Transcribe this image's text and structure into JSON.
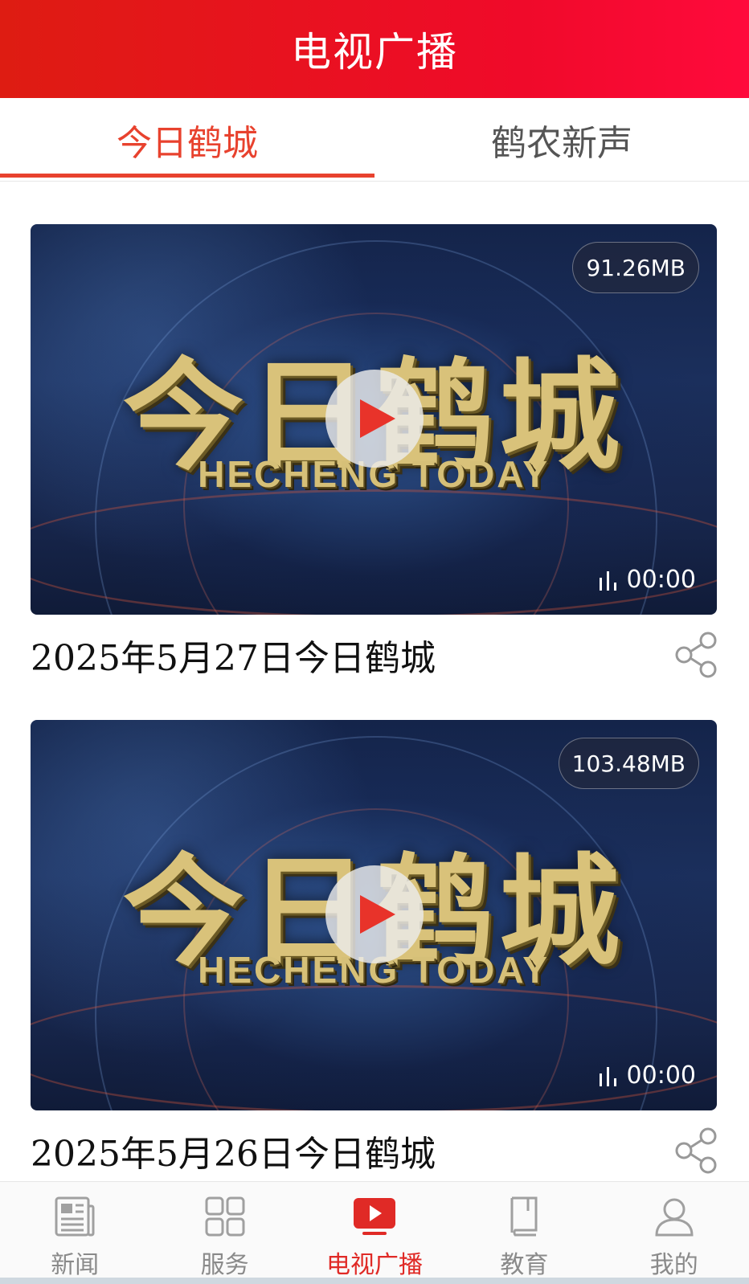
{
  "header": {
    "title": "电视广播"
  },
  "tabs": [
    {
      "label": "今日鹤城",
      "active": true
    },
    {
      "label": "鹤农新声",
      "active": false
    }
  ],
  "videos": [
    {
      "thumb_title_cn": "今日鹤城",
      "thumb_title_en": "HECHENG TODAY",
      "size": "91.26MB",
      "duration": "00:00",
      "title": "2025年5月27日今日鹤城"
    },
    {
      "thumb_title_cn": "今日鹤城",
      "thumb_title_en": "HECHENG TODAY",
      "size": "103.48MB",
      "duration": "00:00",
      "title": "2025年5月26日今日鹤城"
    }
  ],
  "bottom_nav": [
    {
      "label": "新闻",
      "icon": "newspaper-icon",
      "active": false
    },
    {
      "label": "服务",
      "icon": "grid-icon",
      "active": false
    },
    {
      "label": "电视广播",
      "icon": "tv-play-icon",
      "active": true
    },
    {
      "label": "教育",
      "icon": "book-icon",
      "active": false
    },
    {
      "label": "我的",
      "icon": "user-icon",
      "active": false
    }
  ],
  "colors": {
    "header_start": "#de1c12",
    "header_end": "#ff0a3c",
    "accent": "#e8422e",
    "nav_active": "#e02a26",
    "nav_inactive": "#8a8a8a"
  }
}
